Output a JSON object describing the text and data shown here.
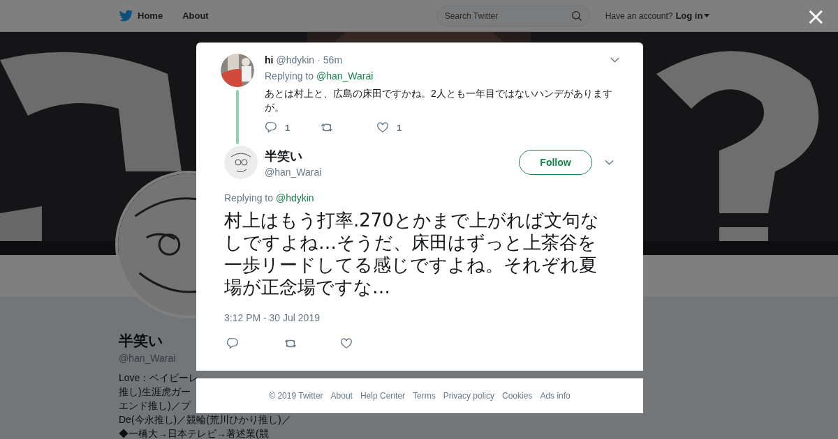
{
  "nav": {
    "home": "Home",
    "about": "About",
    "search_placeholder": "Search Twitter",
    "account_prompt": "Have an account?",
    "login": "Log in"
  },
  "profile": {
    "name": "半笑い",
    "handle": "@han_Warai",
    "bio_lines": [
      "Love：ベイビーレ",
      "推し)生涯虎ガー",
      "エンド推し)／プ",
      "De(今永推し)／競輪(荒川ひかり推し)／",
      "◆一橋大→日本テレビ→著述業(競"
    ]
  },
  "close": "×",
  "parent_tweet": {
    "name": "hi",
    "handle": "@hdykin",
    "separator": "·",
    "time": "56m",
    "replying_label": "Replying to",
    "replying_handle": "@han_Warai",
    "text": "あとは村上と、広島の床田ですかね。2人とも一年目ではないハンデがありますが。",
    "reply_count": "1",
    "like_count": "1"
  },
  "tweet": {
    "name": "半笑い",
    "handle": "@han_Warai",
    "follow": "Follow",
    "replying_label": "Replying to",
    "replying_handle": "@hdykin",
    "text": "村上はもう打率.270とかまで上がれば文句なしですよね…そうだ、床田はずっと上茶谷を一歩リードしてる感じですよね。それぞれ夏場が正念場ですな…",
    "timestamp": "3:12 PM - 30 Jul 2019"
  },
  "footer": [
    "© 2019 Twitter",
    "About",
    "Help Center",
    "Terms",
    "Privacy policy",
    "Cookies",
    "Ads info"
  ]
}
